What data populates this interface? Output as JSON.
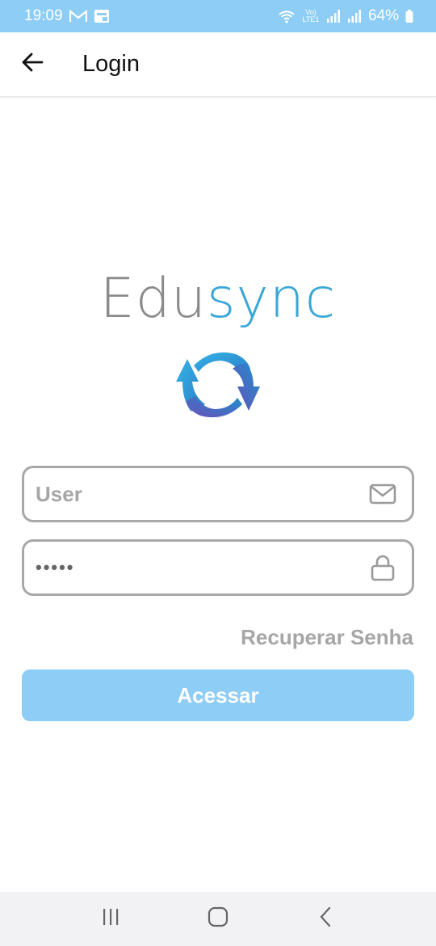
{
  "status_bar": {
    "time": "19:09",
    "battery": "64%",
    "network": "Vo) LTE1"
  },
  "app_bar": {
    "title": "Login",
    "back_icon": "arrow-left-icon"
  },
  "logo": {
    "part1": "Edu",
    "part2": "sync",
    "icon": "sync-arrows-icon"
  },
  "form": {
    "user_placeholder": "User",
    "user_value": "",
    "password_value": "•••••",
    "user_icon": "envelope-icon",
    "password_icon": "lock-icon"
  },
  "recover_label": "Recuperar Senha",
  "submit_label": "Acessar",
  "colors": {
    "accent": "#8ecdf5",
    "brand_blue": "#3aa6d8",
    "brand_gray": "#8a8a8a",
    "field_border": "#a8a8a8"
  },
  "nav": {
    "recents": "recents-icon",
    "home": "home-icon",
    "back": "back-chevron-icon"
  }
}
